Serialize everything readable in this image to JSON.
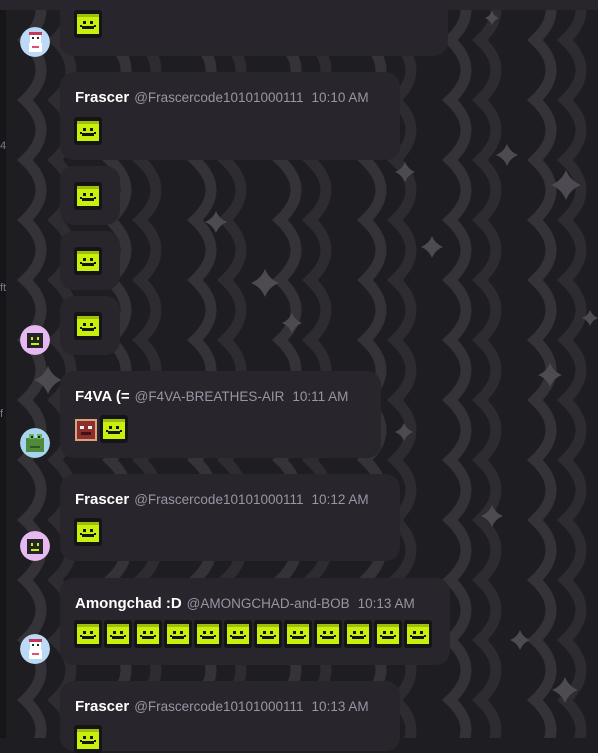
{
  "theme": {
    "background": "#1e1d21",
    "bubble": "#28252d",
    "emoji_green": "#c8f00b",
    "name_color": "#ffffff",
    "meta_color": "#9a95a3"
  },
  "icons": {
    "emoji": "green-face-emoji",
    "avatar_snowman": "snowman-avatar",
    "avatar_robot": "robot-avatar",
    "avatar_frog": "frog-avatar"
  },
  "messages": [
    {
      "author": "",
      "handle": "",
      "time": "",
      "emoji_count": 1
    },
    {
      "author": "Frascer",
      "handle": "@Frascercode10101000111",
      "time": "10:10 AM",
      "emoji_count": 1
    },
    {
      "author": "",
      "handle": "",
      "time": "",
      "emoji_count": 1
    },
    {
      "author": "",
      "handle": "",
      "time": "",
      "emoji_count": 1
    },
    {
      "author": "",
      "handle": "",
      "time": "",
      "emoji_count": 1
    },
    {
      "author": "F4VA (=",
      "handle": "@F4VA-BREATHES-AIR",
      "time": "10:11 AM",
      "emoji_count": 2
    },
    {
      "author": "Frascer",
      "handle": "@Frascercode10101000111",
      "time": "10:12 AM",
      "emoji_count": 1
    },
    {
      "author": "Amongchad :D",
      "handle": "@AMONGCHAD-and-BOB",
      "time": "10:13 AM",
      "emoji_count": 12
    },
    {
      "author": "Frascer",
      "handle": "@Frascercode10101000111",
      "time": "10:13 AM",
      "emoji_count": 1
    }
  ]
}
